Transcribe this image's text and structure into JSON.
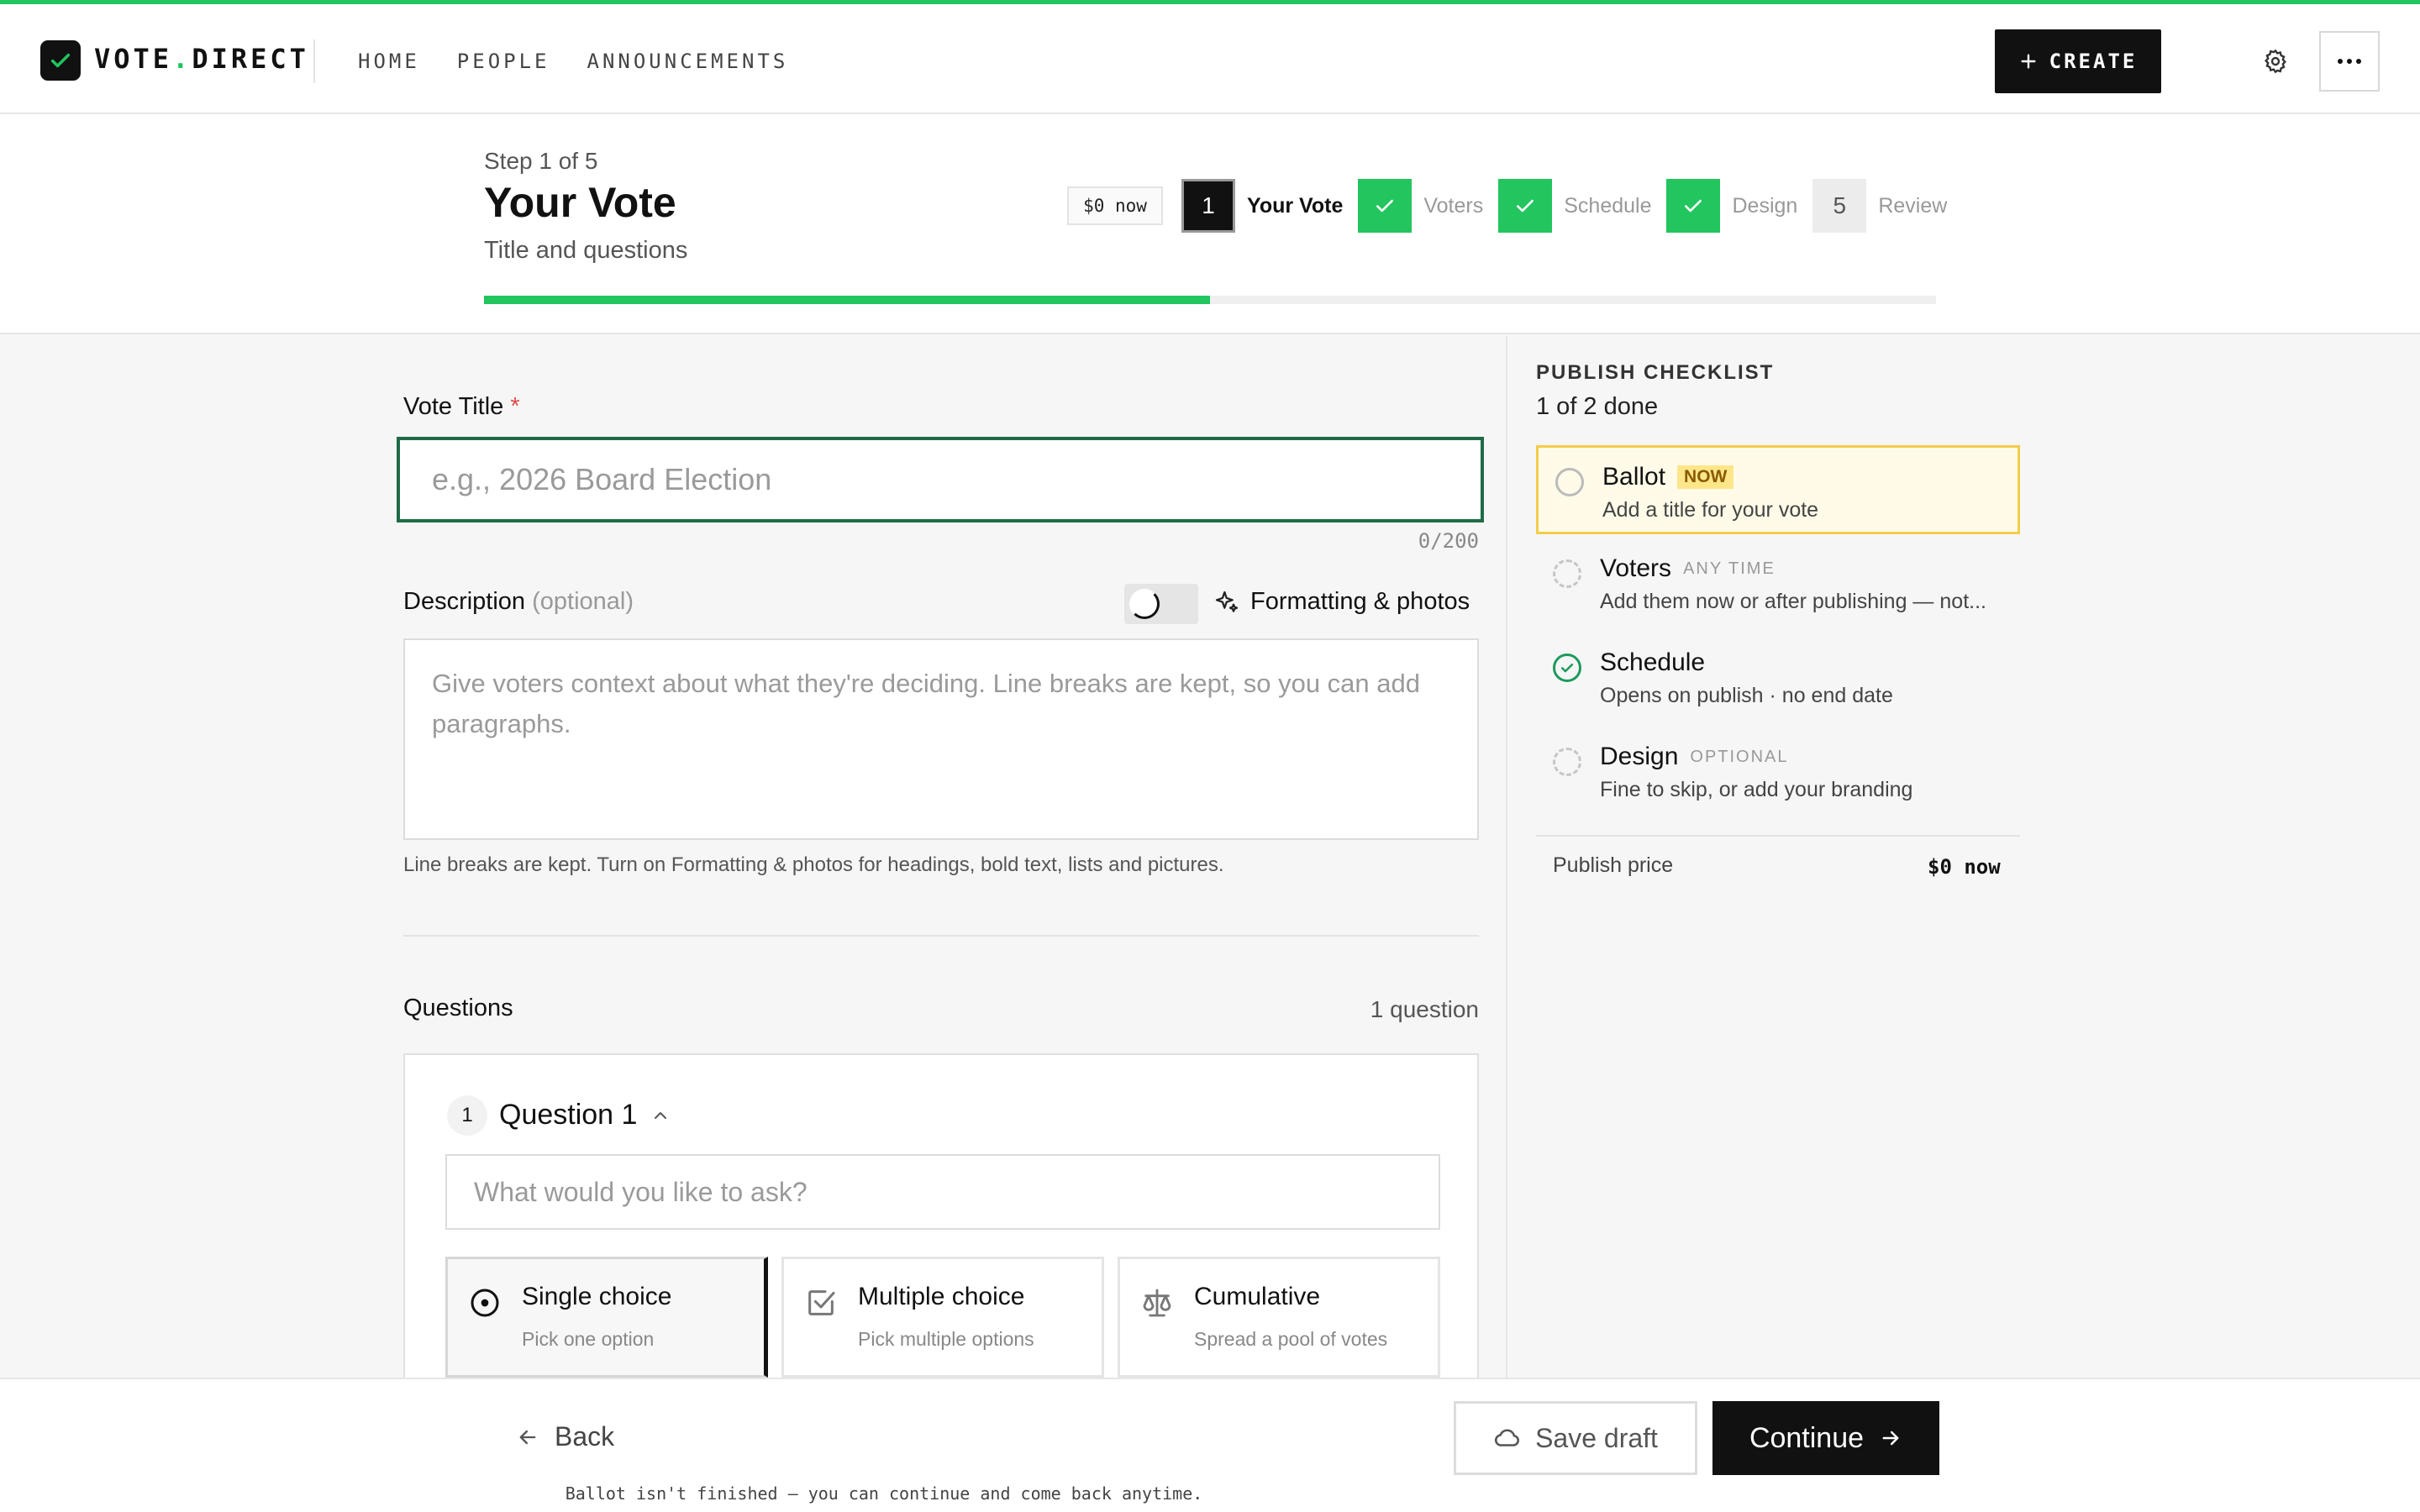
{
  "app": {
    "logo_main": "VOTE",
    "logo_dot": ".",
    "logo_tail": "DIRECT",
    "accent": "#22c55e"
  },
  "nav": {
    "links": [
      "HOME",
      "PEOPLE",
      "ANNOUNCEMENTS"
    ],
    "create_label": "CREATE"
  },
  "step": {
    "of_label": "Step 1 of 5",
    "title": "Your Vote",
    "subtitle": "Title and questions",
    "price_pill": "$0 now",
    "progress": 0.5,
    "steps": [
      {
        "marker": "1",
        "label": "Your Vote",
        "state": "active"
      },
      {
        "marker": "",
        "label": "Voters",
        "state": "done"
      },
      {
        "marker": "",
        "label": "Schedule",
        "state": "done"
      },
      {
        "marker": "",
        "label": "Design",
        "state": "done"
      },
      {
        "marker": "5",
        "label": "Review",
        "state": "todo"
      }
    ]
  },
  "form": {
    "title_label": "Vote Title",
    "required_mark": "*",
    "title_value": "",
    "title_placeholder": "e.g., 2026 Board Election",
    "counter": "0/200",
    "desc_label": "Description",
    "desc_optional": "(optional)",
    "formatting_label": "Formatting & photos",
    "desc_value": "",
    "desc_placeholder": "Give voters context about what they're deciding. Line breaks are kept, so you can add paragraphs.",
    "desc_hint": "Line breaks are kept. Turn on Formatting & photos for headings, bold text, lists and pictures."
  },
  "questions": {
    "label": "Questions",
    "count": "1 question",
    "items": [
      {
        "number": "1",
        "title": "Question 1",
        "placeholder": "What would you like to ask?",
        "types": [
          {
            "name": "Single choice",
            "desc": "Pick one option",
            "icon": "radio-icon",
            "selected": true
          },
          {
            "name": "Multiple choice",
            "desc": "Pick multiple options",
            "icon": "checkbox-icon",
            "selected": false
          },
          {
            "name": "Cumulative",
            "desc": "Spread a pool of votes",
            "icon": "scale-icon",
            "selected": false
          }
        ]
      }
    ]
  },
  "checklist": {
    "heading": "PUBLISH CHECKLIST",
    "done": "1 of 2 done",
    "items": [
      {
        "name": "Ballot",
        "tag": "NOW",
        "desc": "Add a title for your vote",
        "state": "current"
      },
      {
        "name": "Voters",
        "tag": "ANY TIME",
        "desc": "Add them now or after publishing — not...",
        "state": "pending"
      },
      {
        "name": "Schedule",
        "tag": "",
        "desc": "Opens on publish · no end date",
        "state": "done"
      },
      {
        "name": "Design",
        "tag": "OPTIONAL",
        "desc": "Fine to skip, or add your branding",
        "state": "pending"
      }
    ],
    "price_label": "Publish price",
    "price_value": "$0 now"
  },
  "footer": {
    "back": "Back",
    "save": "Save draft",
    "continue": "Continue",
    "note": "Ballot isn't finished — you can continue and come back anytime."
  }
}
